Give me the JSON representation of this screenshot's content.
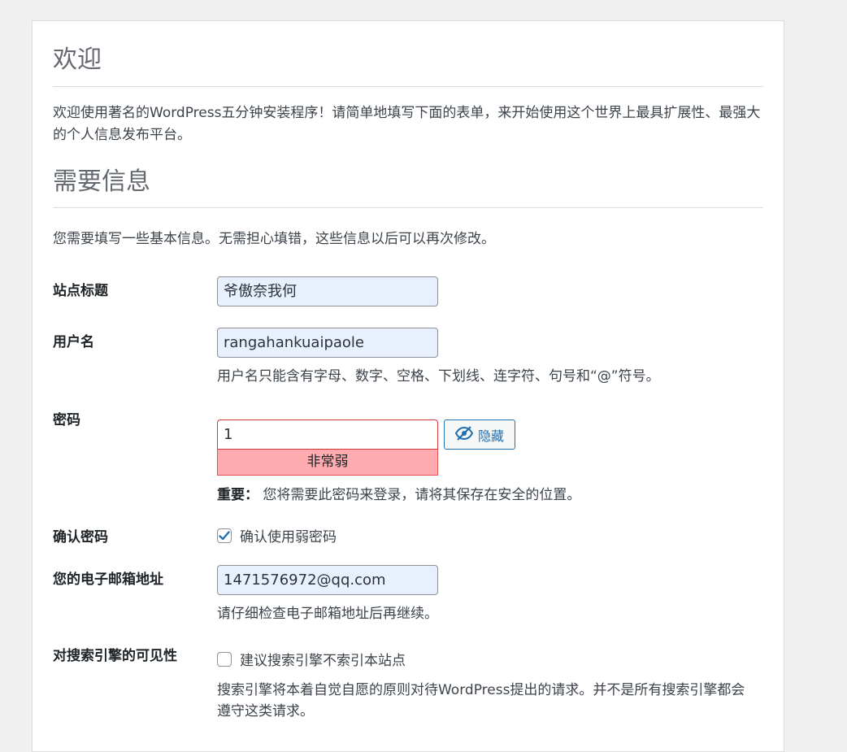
{
  "welcome": {
    "heading": "欢迎",
    "text": "欢迎使用著名的WordPress五分钟安装程序！请简单地填写下面的表单，来开始使用这个世界上最具扩展性、最强大的个人信息发布平台。"
  },
  "info": {
    "heading": "需要信息",
    "text": "您需要填写一些基本信息。无需担心填错，这些信息以后可以再次修改。"
  },
  "form": {
    "site_title": {
      "label": "站点标题",
      "value": "爷傲奈我何"
    },
    "username": {
      "label": "用户名",
      "value": "rangahankuaipaole",
      "hint": "用户名只能含有字母、数字、空格、下划线、连字符、句号和“@”符号。"
    },
    "password": {
      "label": "密码",
      "value": "1",
      "strength": "非常弱",
      "hide_button": "隐藏",
      "hint_strong": "重要：",
      "hint": "您将需要此密码来登录，请将其保存在安全的位置。"
    },
    "confirm_password": {
      "label": "确认密码",
      "checkbox_label": "确认使用弱密码",
      "checked": true
    },
    "email": {
      "label": "您的电子邮箱地址",
      "value": "1471576972@qq.com",
      "hint": "请仔细检查电子邮箱地址后再继续。"
    },
    "search_visibility": {
      "label": "对搜索引擎的可见性",
      "checkbox_label": "建议搜索引擎不索引本站点",
      "checked": false,
      "note": "搜索引擎将本着自觉自愿的原则对待WordPress提出的请求。并不是所有搜索引擎都会遵守这类请求。"
    }
  },
  "colors": {
    "accent": "#2271b1",
    "weak": "#ffabaf"
  }
}
